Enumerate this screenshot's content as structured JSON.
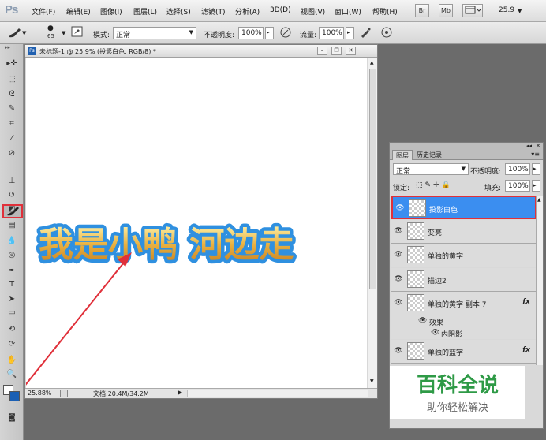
{
  "app_logo": "Ps",
  "menu": [
    "文件(F)",
    "编辑(E)",
    "图像(I)",
    "图层(L)",
    "选择(S)",
    "滤镜(T)",
    "分析(A)",
    "3D(D)",
    "视图(V)",
    "窗口(W)",
    "帮助(H)"
  ],
  "top_buttons": [
    "Br",
    "Mb"
  ],
  "top_zoom": "25.9",
  "options": {
    "brush_size": "65",
    "mode_label": "模式:",
    "mode_value": "正常",
    "opacity_label": "不透明度:",
    "opacity_value": "100%",
    "flow_label": "流量:",
    "flow_value": "100%"
  },
  "document": {
    "title": "未标题-1 @ 25.9% (投影白色, RGB/8) *",
    "ps_icon": "Ps",
    "art_text": "我是小鸭 河边走",
    "status_zoom": "25.88%",
    "status_doc": "文档:20.4M/34.2M"
  },
  "layers_panel": {
    "tabs": [
      "图层",
      "历史记录"
    ],
    "blend_mode": "正常",
    "opacity_label": "不透明度:",
    "opacity_value": "100%",
    "lock_label": "锁定:",
    "fill_label": "填充:",
    "fill_value": "100%",
    "layers": [
      {
        "name": "投影白色",
        "selected": true
      },
      {
        "name": "变亮"
      },
      {
        "name": "单独的黄字"
      },
      {
        "name": "描边2"
      },
      {
        "name": "单独的黄字 副本 7",
        "fx": "fx"
      },
      {
        "name": "单独的蓝字",
        "fx": "fx"
      }
    ],
    "effects_label": "效果",
    "inner_shadow_label": "内阴影"
  },
  "watermark": {
    "title": "百科全说",
    "subtitle": "助你轻松解决"
  },
  "colors": {
    "highlight_red": "#e0303a",
    "selection_blue": "#3b8ef0",
    "watermark_green": "#2e9a46"
  }
}
